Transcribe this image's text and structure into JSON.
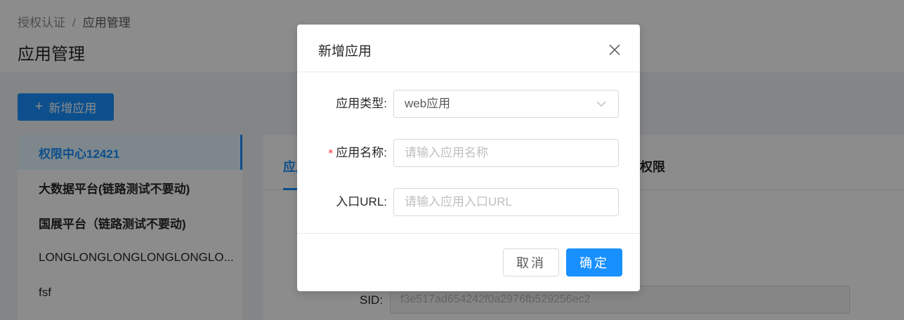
{
  "breadcrumb": {
    "parent": "授权认证",
    "separator": "/",
    "current": "应用管理"
  },
  "page": {
    "title": "应用管理"
  },
  "toolbar": {
    "add_icon": "plus-icon",
    "add_label": "新增应用"
  },
  "app_list": {
    "items": [
      {
        "label": "权限中心12421"
      },
      {
        "label": "大数据平台(链路测试不要动)"
      },
      {
        "label": "国展平台（链路测试不要动)"
      },
      {
        "label": "LONGLONGLONGLONGLONGLO..."
      },
      {
        "label": "fsf"
      }
    ]
  },
  "detail": {
    "tab_active_partial": "应用",
    "tab_partial_right": "权限",
    "sid_label": "SID:",
    "sid_value": "f3e517ad654242f0a2976fb529256ec2"
  },
  "modal": {
    "title": "新增应用",
    "close_icon": "close-icon",
    "type_label": "应用类型:",
    "type_value": "web应用",
    "name_required_mark": "*",
    "name_label": "应用名称:",
    "name_placeholder": "请输入应用名称",
    "url_label": "入口URL:",
    "url_placeholder": "请输入应用入口URL",
    "cancel_label": "取消",
    "ok_label": "确定"
  },
  "colors": {
    "primary": "#1890ff",
    "required": "#f5222d",
    "mask": "rgba(0,0,0,0.45)"
  }
}
